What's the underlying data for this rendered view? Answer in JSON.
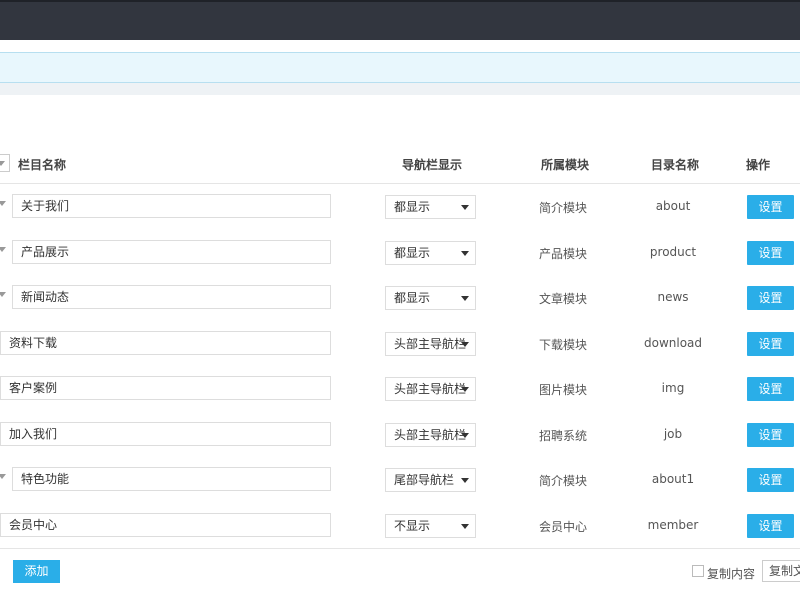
{
  "header": {
    "col_name": "栏目名称",
    "col_nav": "导航栏显示",
    "col_module": "所属模块",
    "col_dir": "目录名称",
    "col_action": "操作"
  },
  "rows": [
    {
      "name": "关于我们",
      "nav": "都显示",
      "module": "简介模块",
      "dir": "about",
      "action": "设置",
      "has_toggle": true
    },
    {
      "name": "产品展示",
      "nav": "都显示",
      "module": "产品模块",
      "dir": "product",
      "action": "设置",
      "has_toggle": true
    },
    {
      "name": "新闻动态",
      "nav": "都显示",
      "module": "文章模块",
      "dir": "news",
      "action": "设置",
      "has_toggle": true
    },
    {
      "name": "资料下载",
      "nav": "头部主导航栏",
      "module": "下载模块",
      "dir": "download",
      "action": "设置",
      "has_toggle": false
    },
    {
      "name": "客户案例",
      "nav": "头部主导航栏",
      "module": "图片模块",
      "dir": "img",
      "action": "设置",
      "has_toggle": false
    },
    {
      "name": "加入我们",
      "nav": "头部主导航栏",
      "module": "招聘系统",
      "dir": "job",
      "action": "设置",
      "has_toggle": false
    },
    {
      "name": "特色功能",
      "nav": "尾部导航栏",
      "module": "简介模块",
      "dir": "about1",
      "action": "设置",
      "has_toggle": true
    },
    {
      "name": "会员中心",
      "nav": "不显示",
      "module": "会员中心",
      "dir": "member",
      "action": "设置",
      "has_toggle": false
    }
  ],
  "footer": {
    "add_label": "添加",
    "copy_label": "复制内容",
    "copy_btn_label": "复制文"
  },
  "colors": {
    "topbar": "#32363f",
    "accent": "#2aaee8",
    "infobar": "#e8f7fd"
  }
}
